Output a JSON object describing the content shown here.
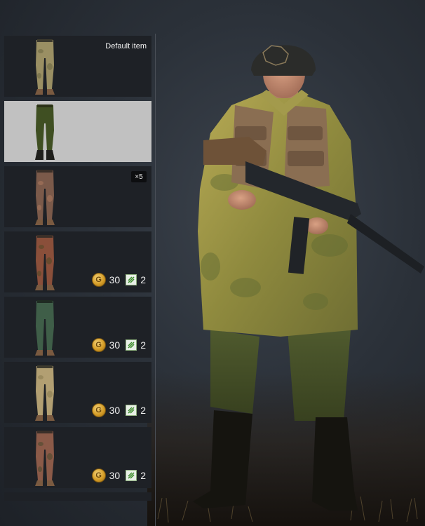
{
  "items": [
    {
      "id": "item-1",
      "label": "Default item",
      "pattern": "tan-camo",
      "selected": false
    },
    {
      "id": "item-2",
      "label": "",
      "pattern": "olive",
      "selected": true
    },
    {
      "id": "item-3",
      "badge": "×5",
      "pattern": "red-camo",
      "selected": false
    },
    {
      "id": "item-4",
      "pattern": "autumn-camo",
      "gold": "30",
      "tickets": "2",
      "selected": false
    },
    {
      "id": "item-5",
      "pattern": "green",
      "gold": "30",
      "tickets": "2",
      "selected": false
    },
    {
      "id": "item-6",
      "pattern": "desert",
      "gold": "30",
      "tickets": "2",
      "selected": false
    },
    {
      "id": "item-7",
      "pattern": "red-camo",
      "gold": "30",
      "tickets": "2",
      "selected": false
    }
  ],
  "colors": {
    "list_bg": "#1e2126",
    "selected_bg": "#c1c1c1",
    "gold": "#d59d27",
    "ticket_green": "#3a8a2a"
  },
  "icons": {
    "currency": "gold-coin-icon",
    "ticket": "order-ticket-icon"
  }
}
